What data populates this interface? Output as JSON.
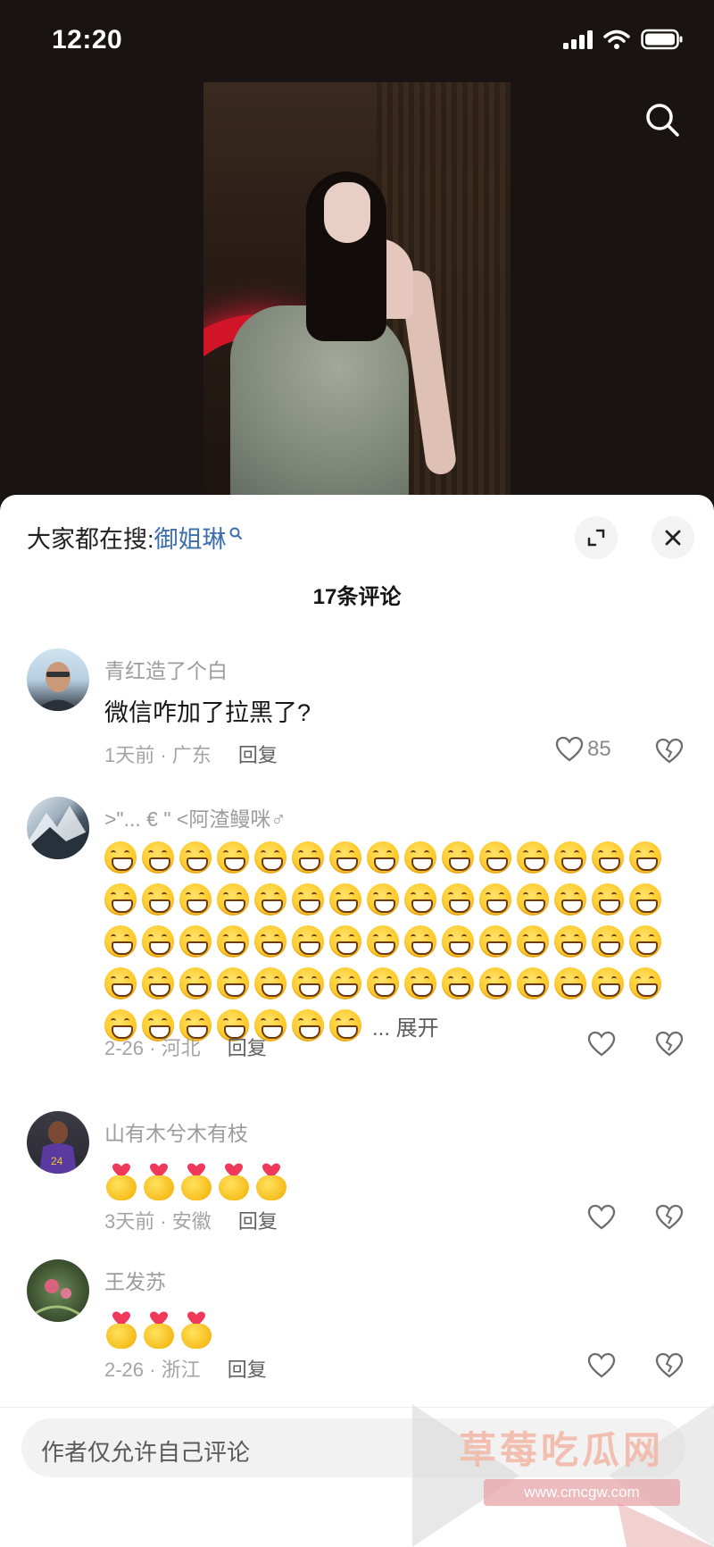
{
  "status_bar": {
    "time": "12:20"
  },
  "hot_search": {
    "prefix": "大家都在搜:",
    "keyword": "御姐琳"
  },
  "comment_count": "17条评论",
  "comments": [
    {
      "user": "青红造了个白",
      "text": "微信咋加了拉黑了?",
      "meta": "1天前 · 广东",
      "reply": "回复",
      "likes": "85"
    },
    {
      "user": ">\"...   € \" <阿渣鳗咪♂",
      "meta": "2-26 · 河北",
      "reply": "回复",
      "expand": "... 展开",
      "emoji_rows": [
        15,
        15,
        15,
        15,
        7
      ]
    },
    {
      "user": "山有木兮木有枝",
      "meta": "3天前 · 安徽",
      "reply": "回复",
      "gift_count": 5
    },
    {
      "user": "王发苏",
      "meta": "2-26 · 浙江",
      "reply": "回复",
      "gift_count": 3
    }
  ],
  "input": {
    "placeholder": "作者仅允许自己评论"
  },
  "watermark": {
    "text": "草莓吃瓜网",
    "url": "www.cmcgw.com"
  },
  "colors": {
    "accent_link": "#3d6fae",
    "background_dark": "#191413"
  }
}
